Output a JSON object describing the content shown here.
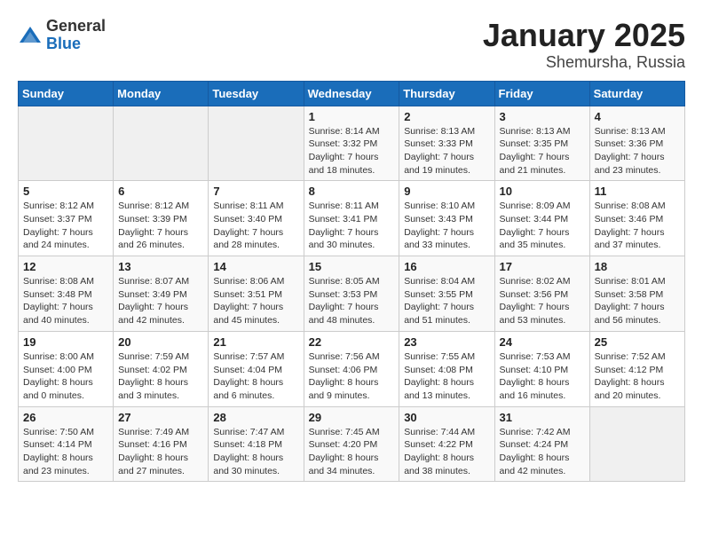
{
  "logo": {
    "general": "General",
    "blue": "Blue"
  },
  "header": {
    "month": "January 2025",
    "location": "Shemursha, Russia"
  },
  "weekdays": [
    "Sunday",
    "Monday",
    "Tuesday",
    "Wednesday",
    "Thursday",
    "Friday",
    "Saturday"
  ],
  "weeks": [
    [
      {
        "day": "",
        "info": ""
      },
      {
        "day": "",
        "info": ""
      },
      {
        "day": "",
        "info": ""
      },
      {
        "day": "1",
        "info": "Sunrise: 8:14 AM\nSunset: 3:32 PM\nDaylight: 7 hours\nand 18 minutes."
      },
      {
        "day": "2",
        "info": "Sunrise: 8:13 AM\nSunset: 3:33 PM\nDaylight: 7 hours\nand 19 minutes."
      },
      {
        "day": "3",
        "info": "Sunrise: 8:13 AM\nSunset: 3:35 PM\nDaylight: 7 hours\nand 21 minutes."
      },
      {
        "day": "4",
        "info": "Sunrise: 8:13 AM\nSunset: 3:36 PM\nDaylight: 7 hours\nand 23 minutes."
      }
    ],
    [
      {
        "day": "5",
        "info": "Sunrise: 8:12 AM\nSunset: 3:37 PM\nDaylight: 7 hours\nand 24 minutes."
      },
      {
        "day": "6",
        "info": "Sunrise: 8:12 AM\nSunset: 3:39 PM\nDaylight: 7 hours\nand 26 minutes."
      },
      {
        "day": "7",
        "info": "Sunrise: 8:11 AM\nSunset: 3:40 PM\nDaylight: 7 hours\nand 28 minutes."
      },
      {
        "day": "8",
        "info": "Sunrise: 8:11 AM\nSunset: 3:41 PM\nDaylight: 7 hours\nand 30 minutes."
      },
      {
        "day": "9",
        "info": "Sunrise: 8:10 AM\nSunset: 3:43 PM\nDaylight: 7 hours\nand 33 minutes."
      },
      {
        "day": "10",
        "info": "Sunrise: 8:09 AM\nSunset: 3:44 PM\nDaylight: 7 hours\nand 35 minutes."
      },
      {
        "day": "11",
        "info": "Sunrise: 8:08 AM\nSunset: 3:46 PM\nDaylight: 7 hours\nand 37 minutes."
      }
    ],
    [
      {
        "day": "12",
        "info": "Sunrise: 8:08 AM\nSunset: 3:48 PM\nDaylight: 7 hours\nand 40 minutes."
      },
      {
        "day": "13",
        "info": "Sunrise: 8:07 AM\nSunset: 3:49 PM\nDaylight: 7 hours\nand 42 minutes."
      },
      {
        "day": "14",
        "info": "Sunrise: 8:06 AM\nSunset: 3:51 PM\nDaylight: 7 hours\nand 45 minutes."
      },
      {
        "day": "15",
        "info": "Sunrise: 8:05 AM\nSunset: 3:53 PM\nDaylight: 7 hours\nand 48 minutes."
      },
      {
        "day": "16",
        "info": "Sunrise: 8:04 AM\nSunset: 3:55 PM\nDaylight: 7 hours\nand 51 minutes."
      },
      {
        "day": "17",
        "info": "Sunrise: 8:02 AM\nSunset: 3:56 PM\nDaylight: 7 hours\nand 53 minutes."
      },
      {
        "day": "18",
        "info": "Sunrise: 8:01 AM\nSunset: 3:58 PM\nDaylight: 7 hours\nand 56 minutes."
      }
    ],
    [
      {
        "day": "19",
        "info": "Sunrise: 8:00 AM\nSunset: 4:00 PM\nDaylight: 8 hours\nand 0 minutes."
      },
      {
        "day": "20",
        "info": "Sunrise: 7:59 AM\nSunset: 4:02 PM\nDaylight: 8 hours\nand 3 minutes."
      },
      {
        "day": "21",
        "info": "Sunrise: 7:57 AM\nSunset: 4:04 PM\nDaylight: 8 hours\nand 6 minutes."
      },
      {
        "day": "22",
        "info": "Sunrise: 7:56 AM\nSunset: 4:06 PM\nDaylight: 8 hours\nand 9 minutes."
      },
      {
        "day": "23",
        "info": "Sunrise: 7:55 AM\nSunset: 4:08 PM\nDaylight: 8 hours\nand 13 minutes."
      },
      {
        "day": "24",
        "info": "Sunrise: 7:53 AM\nSunset: 4:10 PM\nDaylight: 8 hours\nand 16 minutes."
      },
      {
        "day": "25",
        "info": "Sunrise: 7:52 AM\nSunset: 4:12 PM\nDaylight: 8 hours\nand 20 minutes."
      }
    ],
    [
      {
        "day": "26",
        "info": "Sunrise: 7:50 AM\nSunset: 4:14 PM\nDaylight: 8 hours\nand 23 minutes."
      },
      {
        "day": "27",
        "info": "Sunrise: 7:49 AM\nSunset: 4:16 PM\nDaylight: 8 hours\nand 27 minutes."
      },
      {
        "day": "28",
        "info": "Sunrise: 7:47 AM\nSunset: 4:18 PM\nDaylight: 8 hours\nand 30 minutes."
      },
      {
        "day": "29",
        "info": "Sunrise: 7:45 AM\nSunset: 4:20 PM\nDaylight: 8 hours\nand 34 minutes."
      },
      {
        "day": "30",
        "info": "Sunrise: 7:44 AM\nSunset: 4:22 PM\nDaylight: 8 hours\nand 38 minutes."
      },
      {
        "day": "31",
        "info": "Sunrise: 7:42 AM\nSunset: 4:24 PM\nDaylight: 8 hours\nand 42 minutes."
      },
      {
        "day": "",
        "info": ""
      }
    ]
  ]
}
